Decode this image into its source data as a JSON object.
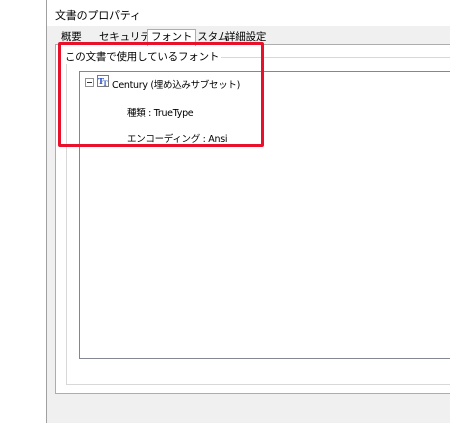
{
  "window": {
    "title": "文書のプロパティ"
  },
  "tabs": [
    {
      "label": "概要"
    },
    {
      "label": "セキュリティ"
    },
    {
      "label": "フォント"
    },
    {
      "label": "カスタム"
    },
    {
      "label": "詳細設定"
    }
  ],
  "fonts_group": {
    "label": "この文書で使用しているフォント",
    "font_entry": {
      "name": "Century (埋め込みサブセット)",
      "type": "種類 : TrueType",
      "encoding": "エンコーディング : Ansi"
    }
  },
  "colors": {
    "highlight": "#e8102a"
  }
}
